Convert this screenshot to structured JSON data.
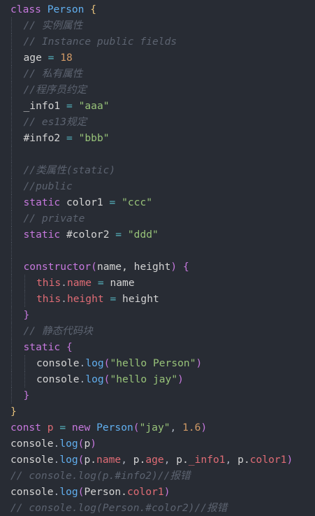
{
  "theme": {
    "background": "#282c34",
    "keyword": "#c678dd",
    "class_name": "#61afef",
    "string": "#98c379",
    "number": "#d19a66",
    "comment": "#5c6370",
    "property": "#e06c75",
    "operator": "#56b6c2"
  },
  "code": {
    "lines": [
      {
        "indent": 0,
        "tokens": [
          [
            "kw",
            "class"
          ],
          [
            "id",
            " "
          ],
          [
            "cls",
            "Person"
          ],
          [
            "id",
            " "
          ],
          [
            "brace",
            "{"
          ]
        ]
      },
      {
        "indent": 1,
        "tokens": [
          [
            "com",
            "// 实例属性"
          ]
        ]
      },
      {
        "indent": 1,
        "tokens": [
          [
            "com",
            "// Instance public fields"
          ]
        ]
      },
      {
        "indent": 1,
        "tokens": [
          [
            "id",
            "age "
          ],
          [
            "op",
            "="
          ],
          [
            "id",
            " "
          ],
          [
            "num",
            "18"
          ]
        ]
      },
      {
        "indent": 1,
        "tokens": [
          [
            "com",
            "// 私有属性"
          ]
        ]
      },
      {
        "indent": 1,
        "tokens": [
          [
            "com",
            "//程序员约定"
          ]
        ]
      },
      {
        "indent": 1,
        "tokens": [
          [
            "id",
            "_info1 "
          ],
          [
            "op",
            "="
          ],
          [
            "id",
            " "
          ],
          [
            "str",
            "\"aaa\""
          ]
        ]
      },
      {
        "indent": 1,
        "tokens": [
          [
            "com",
            "// es13规定"
          ]
        ]
      },
      {
        "indent": 1,
        "tokens": [
          [
            "id",
            "#info2 "
          ],
          [
            "op",
            "="
          ],
          [
            "id",
            " "
          ],
          [
            "str",
            "\"bbb\""
          ]
        ]
      },
      {
        "indent": 1,
        "tokens": []
      },
      {
        "indent": 1,
        "tokens": [
          [
            "com",
            "//类属性(static)"
          ]
        ]
      },
      {
        "indent": 1,
        "tokens": [
          [
            "com",
            "//public"
          ]
        ]
      },
      {
        "indent": 1,
        "tokens": [
          [
            "kw",
            "static"
          ],
          [
            "id",
            " color1 "
          ],
          [
            "op",
            "="
          ],
          [
            "id",
            " "
          ],
          [
            "str",
            "\"ccc\""
          ]
        ]
      },
      {
        "indent": 1,
        "tokens": [
          [
            "com",
            "// private"
          ]
        ]
      },
      {
        "indent": 1,
        "tokens": [
          [
            "kw",
            "static"
          ],
          [
            "id",
            " #color2 "
          ],
          [
            "op",
            "="
          ],
          [
            "id",
            " "
          ],
          [
            "str",
            "\"ddd\""
          ]
        ]
      },
      {
        "indent": 1,
        "tokens": []
      },
      {
        "indent": 1,
        "tokens": [
          [
            "kw",
            "constructor"
          ],
          [
            "paren",
            "("
          ],
          [
            "id",
            "name, height"
          ],
          [
            "paren",
            ")"
          ],
          [
            "id",
            " "
          ],
          [
            "brace2",
            "{"
          ]
        ]
      },
      {
        "indent": 2,
        "tokens": [
          [
            "this",
            "this"
          ],
          [
            "pun",
            "."
          ],
          [
            "prop",
            "name"
          ],
          [
            "id",
            " "
          ],
          [
            "op",
            "="
          ],
          [
            "id",
            " name"
          ]
        ]
      },
      {
        "indent": 2,
        "tokens": [
          [
            "this",
            "this"
          ],
          [
            "pun",
            "."
          ],
          [
            "prop",
            "height"
          ],
          [
            "id",
            " "
          ],
          [
            "op",
            "="
          ],
          [
            "id",
            " height"
          ]
        ]
      },
      {
        "indent": 1,
        "tokens": [
          [
            "brace2",
            "}"
          ]
        ]
      },
      {
        "indent": 1,
        "tokens": [
          [
            "com",
            "// 静态代码块"
          ]
        ]
      },
      {
        "indent": 1,
        "tokens": [
          [
            "kw",
            "static"
          ],
          [
            "id",
            " "
          ],
          [
            "brace2",
            "{"
          ]
        ]
      },
      {
        "indent": 2,
        "tokens": [
          [
            "id",
            "console"
          ],
          [
            "pun",
            "."
          ],
          [
            "fn",
            "log"
          ],
          [
            "paren",
            "("
          ],
          [
            "str",
            "\"hello Person\""
          ],
          [
            "paren",
            ")"
          ]
        ]
      },
      {
        "indent": 2,
        "tokens": [
          [
            "id",
            "console"
          ],
          [
            "pun",
            "."
          ],
          [
            "fn",
            "log"
          ],
          [
            "paren",
            "("
          ],
          [
            "str",
            "\"hello jay\""
          ],
          [
            "paren",
            ")"
          ]
        ]
      },
      {
        "indent": 1,
        "tokens": [
          [
            "brace2",
            "}"
          ]
        ]
      },
      {
        "indent": 0,
        "tokens": [
          [
            "brace",
            "}"
          ]
        ]
      },
      {
        "indent": 0,
        "tokens": [
          [
            "kw",
            "const"
          ],
          [
            "id",
            " "
          ],
          [
            "prop",
            "p"
          ],
          [
            "id",
            " "
          ],
          [
            "op",
            "="
          ],
          [
            "id",
            " "
          ],
          [
            "kw",
            "new"
          ],
          [
            "id",
            " "
          ],
          [
            "cls",
            "Person"
          ],
          [
            "paren",
            "("
          ],
          [
            "str",
            "\"jay\""
          ],
          [
            "pun",
            ", "
          ],
          [
            "num",
            "1.6"
          ],
          [
            "paren",
            ")"
          ]
        ]
      },
      {
        "indent": 0,
        "tokens": [
          [
            "id",
            "console"
          ],
          [
            "pun",
            "."
          ],
          [
            "fn",
            "log"
          ],
          [
            "paren",
            "("
          ],
          [
            "id",
            "p"
          ],
          [
            "paren",
            ")"
          ]
        ]
      },
      {
        "indent": 0,
        "tokens": [
          [
            "id",
            "console"
          ],
          [
            "pun",
            "."
          ],
          [
            "fn",
            "log"
          ],
          [
            "paren",
            "("
          ],
          [
            "id",
            "p."
          ],
          [
            "prop",
            "name"
          ],
          [
            "pun",
            ", "
          ],
          [
            "id",
            "p."
          ],
          [
            "prop",
            "age"
          ],
          [
            "pun",
            ", "
          ],
          [
            "id",
            "p."
          ],
          [
            "prop",
            "_info1"
          ],
          [
            "pun",
            ", "
          ],
          [
            "id",
            "p."
          ],
          [
            "prop",
            "color1"
          ],
          [
            "paren",
            ")"
          ]
        ]
      },
      {
        "indent": 0,
        "tokens": [
          [
            "com",
            "// console.log(p.#info2)//报错"
          ]
        ]
      },
      {
        "indent": 0,
        "tokens": [
          [
            "id",
            "console"
          ],
          [
            "pun",
            "."
          ],
          [
            "fn",
            "log"
          ],
          [
            "paren",
            "("
          ],
          [
            "id",
            "Person."
          ],
          [
            "prop",
            "color1"
          ],
          [
            "paren",
            ")"
          ]
        ]
      },
      {
        "indent": 0,
        "tokens": [
          [
            "com",
            "// console.log(Person.#color2)//报错"
          ]
        ]
      }
    ]
  }
}
